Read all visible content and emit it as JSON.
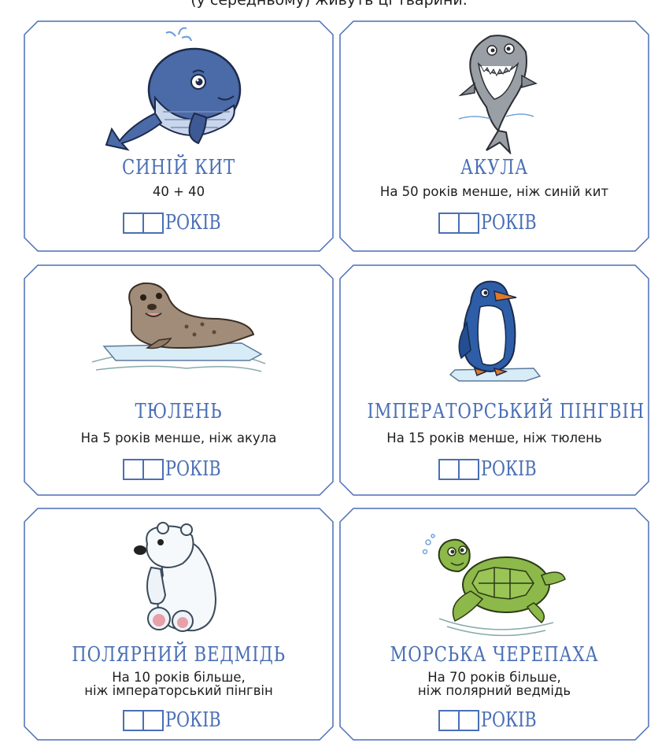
{
  "header": {
    "text": "(у середньому) живуть ці тварини."
  },
  "unit_label": "РОКІВ",
  "cards": [
    {
      "title": "СИНІЙ КИТ",
      "line1": "40 + 40",
      "line2": "",
      "icon": "whale-icon"
    },
    {
      "title": "АКУЛА",
      "line1": "На 50 років менше, ніж синій кит",
      "line2": "",
      "icon": "shark-icon"
    },
    {
      "title": "ТЮЛЕНЬ",
      "line1": "На 5 років менше, ніж акула",
      "line2": "",
      "icon": "seal-icon"
    },
    {
      "title": "ІМПЕРАТОРСЬКИЙ ПІНГВІН",
      "line1": "На 15 років менше, ніж тюлень",
      "line2": "",
      "icon": "penguin-icon"
    },
    {
      "title": "ПОЛЯРНИЙ ВЕДМІДЬ",
      "line1": "На 10 років більше,",
      "line2": "ніж імператорський пінгвін",
      "icon": "polar-bear-icon"
    },
    {
      "title": "МОРСЬКА ЧЕРЕПАХА",
      "line1": "На 70 років більше,",
      "line2": "ніж полярний ведмідь",
      "icon": "sea-turtle-icon"
    }
  ],
  "colors": {
    "frame": "#4a6fb5",
    "title": "#4a6fb5"
  }
}
